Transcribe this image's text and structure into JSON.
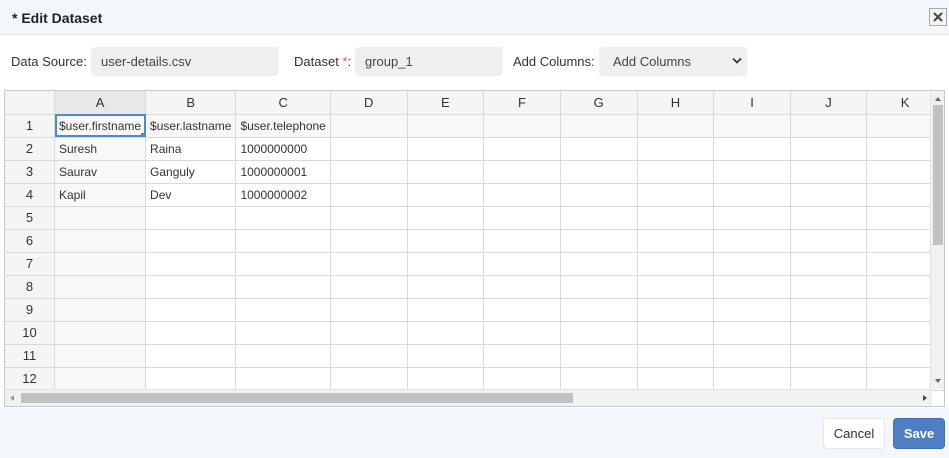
{
  "dialog": {
    "title": "* Edit Dataset",
    "close_icon": "close-icon"
  },
  "form": {
    "data_source_label": "Data Source:",
    "data_source_value": "user-details.csv",
    "dataset_label": "Dataset",
    "dataset_required": "*",
    "dataset_colon": ":",
    "dataset_value": "group_1",
    "add_columns_label": "Add Columns:",
    "add_columns_selected": "Add Columns"
  },
  "grid": {
    "columns": [
      "A",
      "B",
      "C",
      "D",
      "E",
      "F",
      "G",
      "H",
      "I",
      "J",
      "K"
    ],
    "row_numbers": [
      "1",
      "2",
      "3",
      "4",
      "5",
      "6",
      "7",
      "8",
      "9",
      "10",
      "11",
      "12"
    ],
    "rows": [
      [
        "$user.firstname",
        "$user.lastname",
        "$user.telephone",
        "",
        "",
        "",
        "",
        "",
        "",
        "",
        ""
      ],
      [
        "Suresh",
        "Raina",
        "1000000000",
        "",
        "",
        "",
        "",
        "",
        "",
        "",
        ""
      ],
      [
        "Saurav",
        "Ganguly",
        "1000000001",
        "",
        "",
        "",
        "",
        "",
        "",
        "",
        ""
      ],
      [
        "Kapil",
        "Dev",
        "1000000002",
        "",
        "",
        "",
        "",
        "",
        "",
        "",
        ""
      ],
      [
        "",
        "",
        "",
        "",
        "",
        "",
        "",
        "",
        "",
        "",
        ""
      ],
      [
        "",
        "",
        "",
        "",
        "",
        "",
        "",
        "",
        "",
        "",
        ""
      ],
      [
        "",
        "",
        "",
        "",
        "",
        "",
        "",
        "",
        "",
        "",
        ""
      ],
      [
        "",
        "",
        "",
        "",
        "",
        "",
        "",
        "",
        "",
        "",
        ""
      ],
      [
        "",
        "",
        "",
        "",
        "",
        "",
        "",
        "",
        "",
        "",
        ""
      ],
      [
        "",
        "",
        "",
        "",
        "",
        "",
        "",
        "",
        "",
        "",
        ""
      ],
      [
        "",
        "",
        "",
        "",
        "",
        "",
        "",
        "",
        "",
        "",
        ""
      ],
      [
        "",
        "",
        "",
        "",
        "",
        "",
        "",
        "",
        "",
        "",
        ""
      ]
    ],
    "selected_cell": "A1"
  },
  "footer": {
    "cancel_label": "Cancel",
    "save_label": "Save"
  },
  "colors": {
    "accent": "#4b89dc",
    "save_button": "#4f7ec4",
    "required": "#d9534f"
  }
}
